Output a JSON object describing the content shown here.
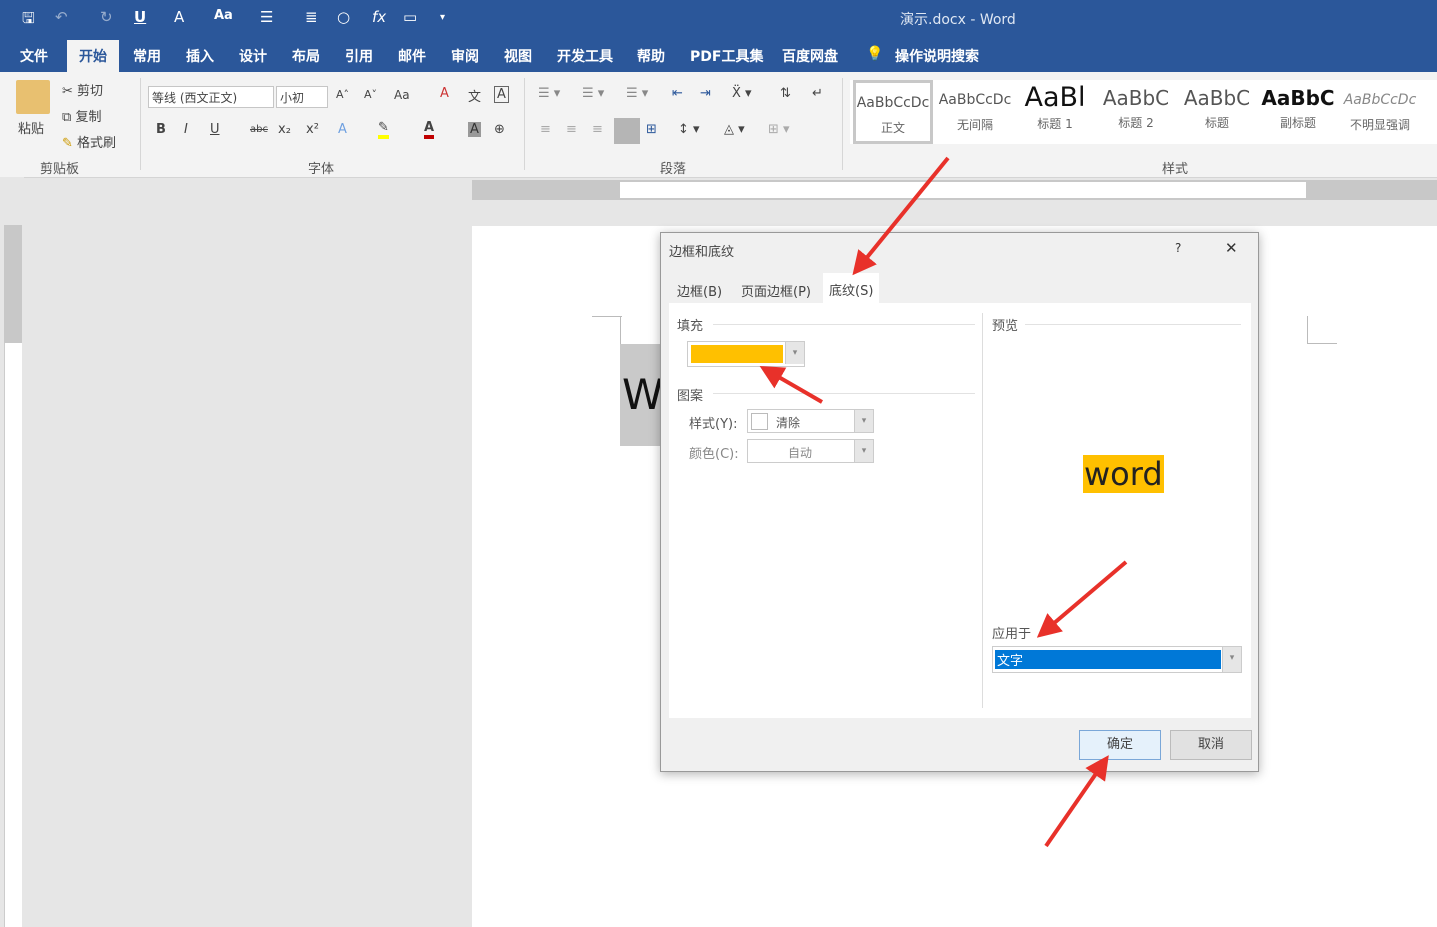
{
  "title_bar": {
    "document_title": "演示.docx - Word",
    "quick_access": [
      "save",
      "undo",
      "redo",
      "underline",
      "font-effect",
      "change-case",
      "bullets",
      "align",
      "shape",
      "formula",
      "comment",
      "customize"
    ]
  },
  "tabs": [
    {
      "label": "文件"
    },
    {
      "label": "开始",
      "active": true
    },
    {
      "label": "常用"
    },
    {
      "label": "插入"
    },
    {
      "label": "设计"
    },
    {
      "label": "布局"
    },
    {
      "label": "引用"
    },
    {
      "label": "邮件"
    },
    {
      "label": "审阅"
    },
    {
      "label": "视图"
    },
    {
      "label": "开发工具"
    },
    {
      "label": "帮助"
    },
    {
      "label": "PDF工具集"
    },
    {
      "label": "百度网盘"
    }
  ],
  "search": {
    "label": "操作说明搜索"
  },
  "ribbon": {
    "clipboard": {
      "paste": "粘贴",
      "cut": "剪切",
      "copy": "复制",
      "format_painter": "格式刷",
      "group": "剪贴板"
    },
    "font": {
      "font_name": "等线 (西文正文)",
      "font_size": "小初",
      "bold": "B",
      "italic": "I",
      "underline": "U",
      "strike": "abc",
      "sub": "x₂",
      "sup": "x²",
      "grow": "A˄",
      "shrink": "A˅",
      "case": "Aa",
      "group": "字体",
      "color_text": "A",
      "color_accent": "#c00000",
      "highlight": "#ffff00"
    },
    "paragraph": {
      "group": "段落"
    },
    "styles": {
      "group": "样式",
      "items": [
        {
          "preview": "AaBbCcDc",
          "name": "正文"
        },
        {
          "preview": "AaBbCcDc",
          "name": "无间隔"
        },
        {
          "preview": "AaBl",
          "name": "标题 1"
        },
        {
          "preview": "AaBbC",
          "name": "标题 2"
        },
        {
          "preview": "AaBbC",
          "name": "标题"
        },
        {
          "preview": "AaBbC",
          "name": "副标题"
        },
        {
          "preview": "AaBbCcDc",
          "name": "不明显强调"
        }
      ]
    }
  },
  "document": {
    "text_fragment": "W"
  },
  "dialog": {
    "title": "边框和底纹",
    "help": "?",
    "close": "✕",
    "tabs": [
      {
        "label": "边框(B)"
      },
      {
        "label": "页面边框(P)"
      },
      {
        "label": "底纹(S)",
        "active": true
      }
    ],
    "fill": {
      "label": "填充",
      "color": "#ffc000"
    },
    "pattern": {
      "label": "图案",
      "style_label": "样式(Y):",
      "style_value": "清除",
      "color_label": "颜色(C):",
      "color_value": "自动"
    },
    "preview": {
      "label": "预览",
      "sample": "word"
    },
    "apply_to": {
      "label": "应用于",
      "value": "文字"
    },
    "ok": "确定",
    "cancel": "取消"
  },
  "colors": {
    "brand": "#2b579a",
    "annotation_arrow": "#e8312a",
    "selection": "#0078d7"
  }
}
